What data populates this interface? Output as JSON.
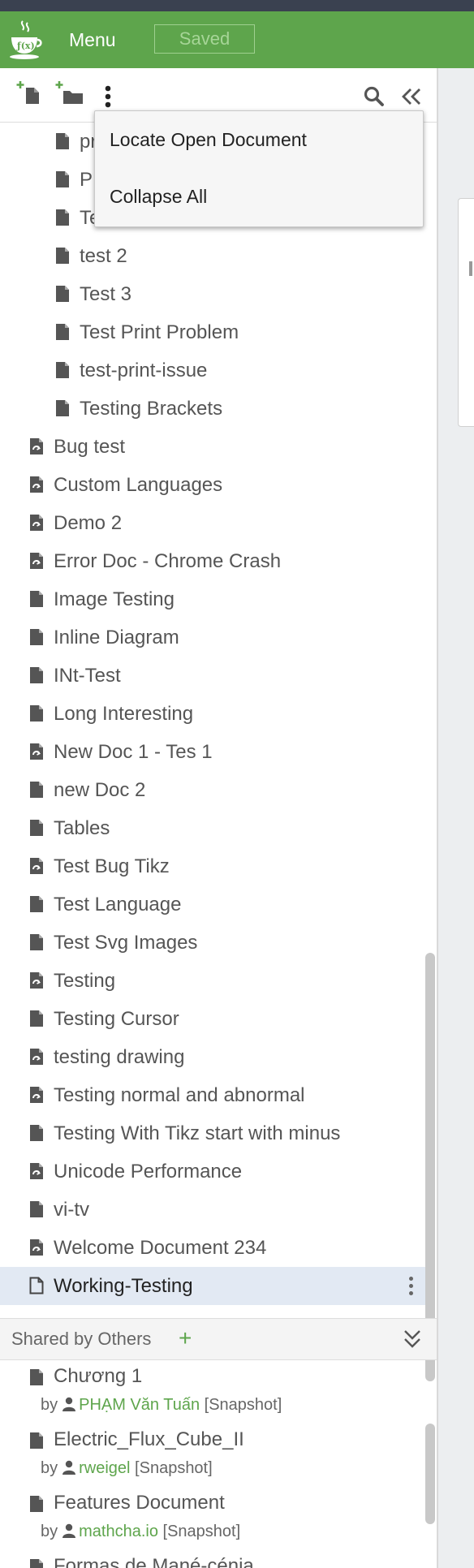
{
  "header": {
    "menu_label": "Menu",
    "saved_label": "Saved",
    "accent_color": "#5ea54c"
  },
  "toolbar": {
    "icons": [
      "add-document-icon",
      "add-folder-icon",
      "more-vertical-icon",
      "search-icon",
      "collapse-sidebar-icon"
    ]
  },
  "context_menu": {
    "items": [
      {
        "label": "Locate Open Document"
      },
      {
        "label": "Collapse All"
      }
    ]
  },
  "tree": {
    "items": [
      {
        "label": "pr",
        "indent": 1,
        "icon": "file"
      },
      {
        "label": "P",
        "indent": 1,
        "icon": "file"
      },
      {
        "label": "Te",
        "indent": 1,
        "icon": "file"
      },
      {
        "label": "test 2",
        "indent": 1,
        "icon": "file"
      },
      {
        "label": "Test 3",
        "indent": 1,
        "icon": "file"
      },
      {
        "label": "Test Print Problem",
        "indent": 1,
        "icon": "file"
      },
      {
        "label": "test-print-issue",
        "indent": 1,
        "icon": "file"
      },
      {
        "label": "Testing Brackets",
        "indent": 1,
        "icon": "file"
      },
      {
        "label": "Bug test",
        "indent": 0,
        "icon": "shared-file"
      },
      {
        "label": "Custom Languages",
        "indent": 0,
        "icon": "shared-file"
      },
      {
        "label": "Demo 2",
        "indent": 0,
        "icon": "shared-file"
      },
      {
        "label": "Error Doc - Chrome Crash",
        "indent": 0,
        "icon": "shared-file"
      },
      {
        "label": "Image Testing",
        "indent": 0,
        "icon": "file"
      },
      {
        "label": "Inline Diagram",
        "indent": 0,
        "icon": "file"
      },
      {
        "label": "INt-Test",
        "indent": 0,
        "icon": "file"
      },
      {
        "label": "Long Interesting",
        "indent": 0,
        "icon": "file"
      },
      {
        "label": "New Doc 1 - Tes 1",
        "indent": 0,
        "icon": "shared-file"
      },
      {
        "label": "new Doc 2",
        "indent": 0,
        "icon": "file"
      },
      {
        "label": "Tables",
        "indent": 0,
        "icon": "file"
      },
      {
        "label": "Test Bug Tikz",
        "indent": 0,
        "icon": "shared-file"
      },
      {
        "label": "Test Language",
        "indent": 0,
        "icon": "file"
      },
      {
        "label": "Test Svg Images",
        "indent": 0,
        "icon": "file"
      },
      {
        "label": "Testing",
        "indent": 0,
        "icon": "shared-file"
      },
      {
        "label": "Testing Cursor",
        "indent": 0,
        "icon": "file"
      },
      {
        "label": "testing drawing",
        "indent": 0,
        "icon": "shared-file"
      },
      {
        "label": "Testing normal and abnormal",
        "indent": 0,
        "icon": "shared-file"
      },
      {
        "label": "Testing With Tikz start with minus",
        "indent": 0,
        "icon": "file"
      },
      {
        "label": "Unicode Performance",
        "indent": 0,
        "icon": "shared-file"
      },
      {
        "label": "vi-tv",
        "indent": 0,
        "icon": "file"
      },
      {
        "label": "Welcome Document 234",
        "indent": 0,
        "icon": "shared-file"
      },
      {
        "label": "Working-Testing",
        "indent": 0,
        "icon": "file-outline",
        "selected": true
      }
    ]
  },
  "shared": {
    "title": "Shared by Others",
    "by_label": "by",
    "items": [
      {
        "name": "Chương 1",
        "user": "PHẠM Văn Tuấn",
        "tag": "[Snapshot]"
      },
      {
        "name": "Electric_Flux_Cube_II",
        "user": "rweigel",
        "tag": "[Snapshot]"
      },
      {
        "name": "Features Document",
        "user": "mathcha.io",
        "tag": "[Snapshot]"
      },
      {
        "name": "Formas de Mané-cénia",
        "user": "",
        "tag": ""
      }
    ]
  }
}
